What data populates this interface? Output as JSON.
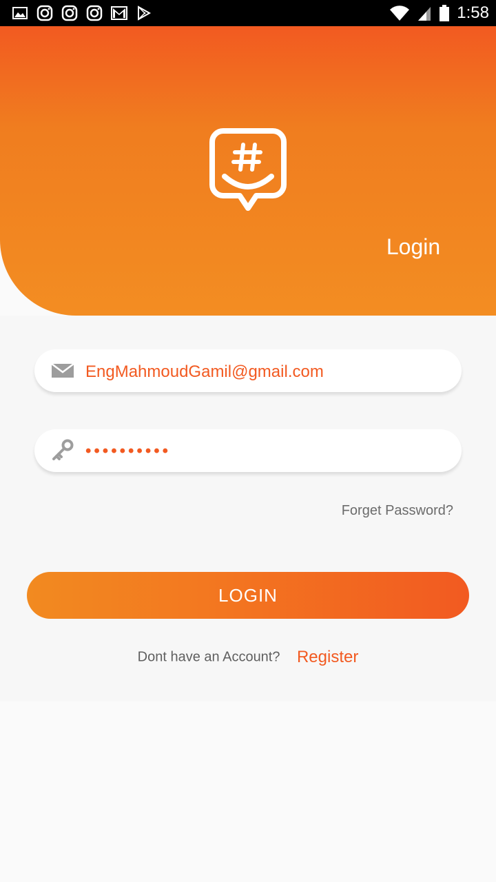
{
  "status_bar": {
    "time": "1:58",
    "icons": [
      "image-icon",
      "instagram-icon",
      "instagram-icon",
      "instagram-icon",
      "gmail-icon",
      "play-store-icon"
    ]
  },
  "header": {
    "title": "Login",
    "logo": "chat-hashtag-logo"
  },
  "form": {
    "email": {
      "icon": "mail-icon",
      "value": "EngMahmoudGamil@gmail.com"
    },
    "password": {
      "icon": "key-icon",
      "value": "••••••••••"
    },
    "forget_password": "Forget Password?",
    "login_button": "LOGIN",
    "register_prompt": "Dont have an Account?",
    "register_link": "Register"
  },
  "colors": {
    "accent": "#f25a21",
    "accent_light": "#f38d22",
    "text_secondary": "#6b6b6b"
  }
}
